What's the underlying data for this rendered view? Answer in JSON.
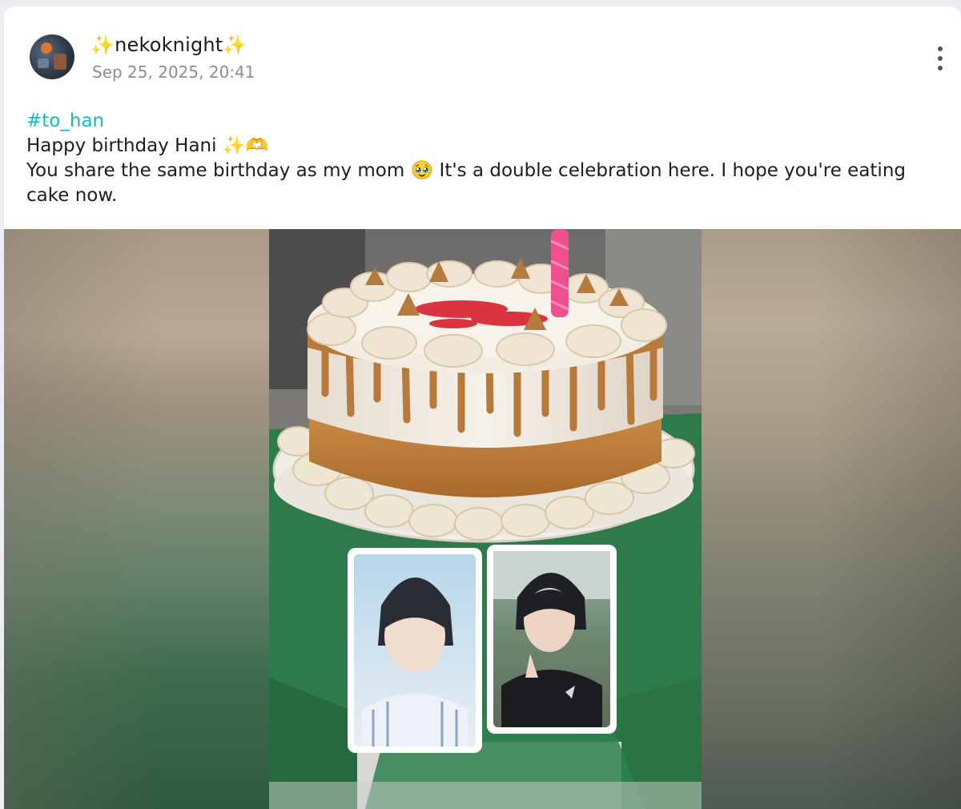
{
  "post": {
    "username": "✨nekoknight✨",
    "timestamp": "Sep 25, 2025, 20:41",
    "hashtag": "#to_han",
    "line1": "Happy birthday Hani ✨🫶",
    "line2": "You share the same birthday as my mom 🥹 It's a double celebration here. I hope you're eating cake now."
  },
  "icons": {
    "avatar": "avatar-icon",
    "more": "more-vertical-icon"
  },
  "colors": {
    "hashtag": "#19b5c6",
    "timestamp": "#8d8d8d"
  }
}
